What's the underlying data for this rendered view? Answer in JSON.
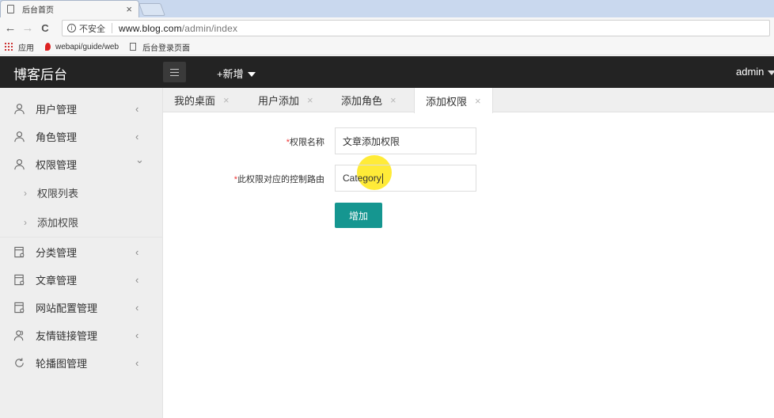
{
  "browser": {
    "tab_title": "后台首页",
    "tab_close": "×",
    "back_icon": "←",
    "forward_icon": "→",
    "reload_icon": "C",
    "info_icon": "i",
    "insecure_text": "不安全",
    "url_host": "www.blog.com",
    "url_path": "/admin/index",
    "bookmarks": [
      {
        "label": "应用",
        "icon": "apps-icon"
      },
      {
        "label": "webapi/guide/web",
        "icon": "pin-icon"
      },
      {
        "label": "后台登录页面",
        "icon": "page-icon"
      }
    ]
  },
  "header": {
    "logo": "博客后台",
    "new_label": "+新增",
    "user": "admin"
  },
  "sidebar": {
    "items": [
      {
        "label": "用户管理",
        "icon": "user-icon",
        "arrow": "‹"
      },
      {
        "label": "角色管理",
        "icon": "user-icon",
        "arrow": "‹"
      },
      {
        "label": "权限管理",
        "icon": "user-icon",
        "arrow": "⌄"
      },
      {
        "label": "分类管理",
        "icon": "document-icon",
        "arrow": "‹"
      },
      {
        "label": "文章管理",
        "icon": "document-icon",
        "arrow": "‹"
      },
      {
        "label": "网站配置管理",
        "icon": "document-icon",
        "arrow": "‹"
      },
      {
        "label": "友情链接管理",
        "icon": "friends-icon",
        "arrow": "‹"
      },
      {
        "label": "轮播图管理",
        "icon": "refresh-icon",
        "arrow": "‹"
      }
    ],
    "subitems": [
      {
        "label": "权限列表",
        "arrow": "›"
      },
      {
        "label": "添加权限",
        "arrow": "›"
      }
    ]
  },
  "tabs": [
    {
      "label": "我的桌面",
      "close": "×",
      "active": false
    },
    {
      "label": "用户添加",
      "close": "×",
      "active": false
    },
    {
      "label": "添加角色",
      "close": "×",
      "active": false
    },
    {
      "label": "添加权限",
      "close": "×",
      "active": true
    }
  ],
  "form": {
    "required_mark": "*",
    "name_label": "权限名称",
    "name_value": "文章添加权限",
    "route_label": "此权限对应的控制路由",
    "route_value": "Category",
    "submit_label": "增加"
  },
  "colors": {
    "header_bg": "#232323",
    "sidebar_bg": "#eeeeee",
    "submit_bg": "#159690",
    "required": "#e33333"
  }
}
